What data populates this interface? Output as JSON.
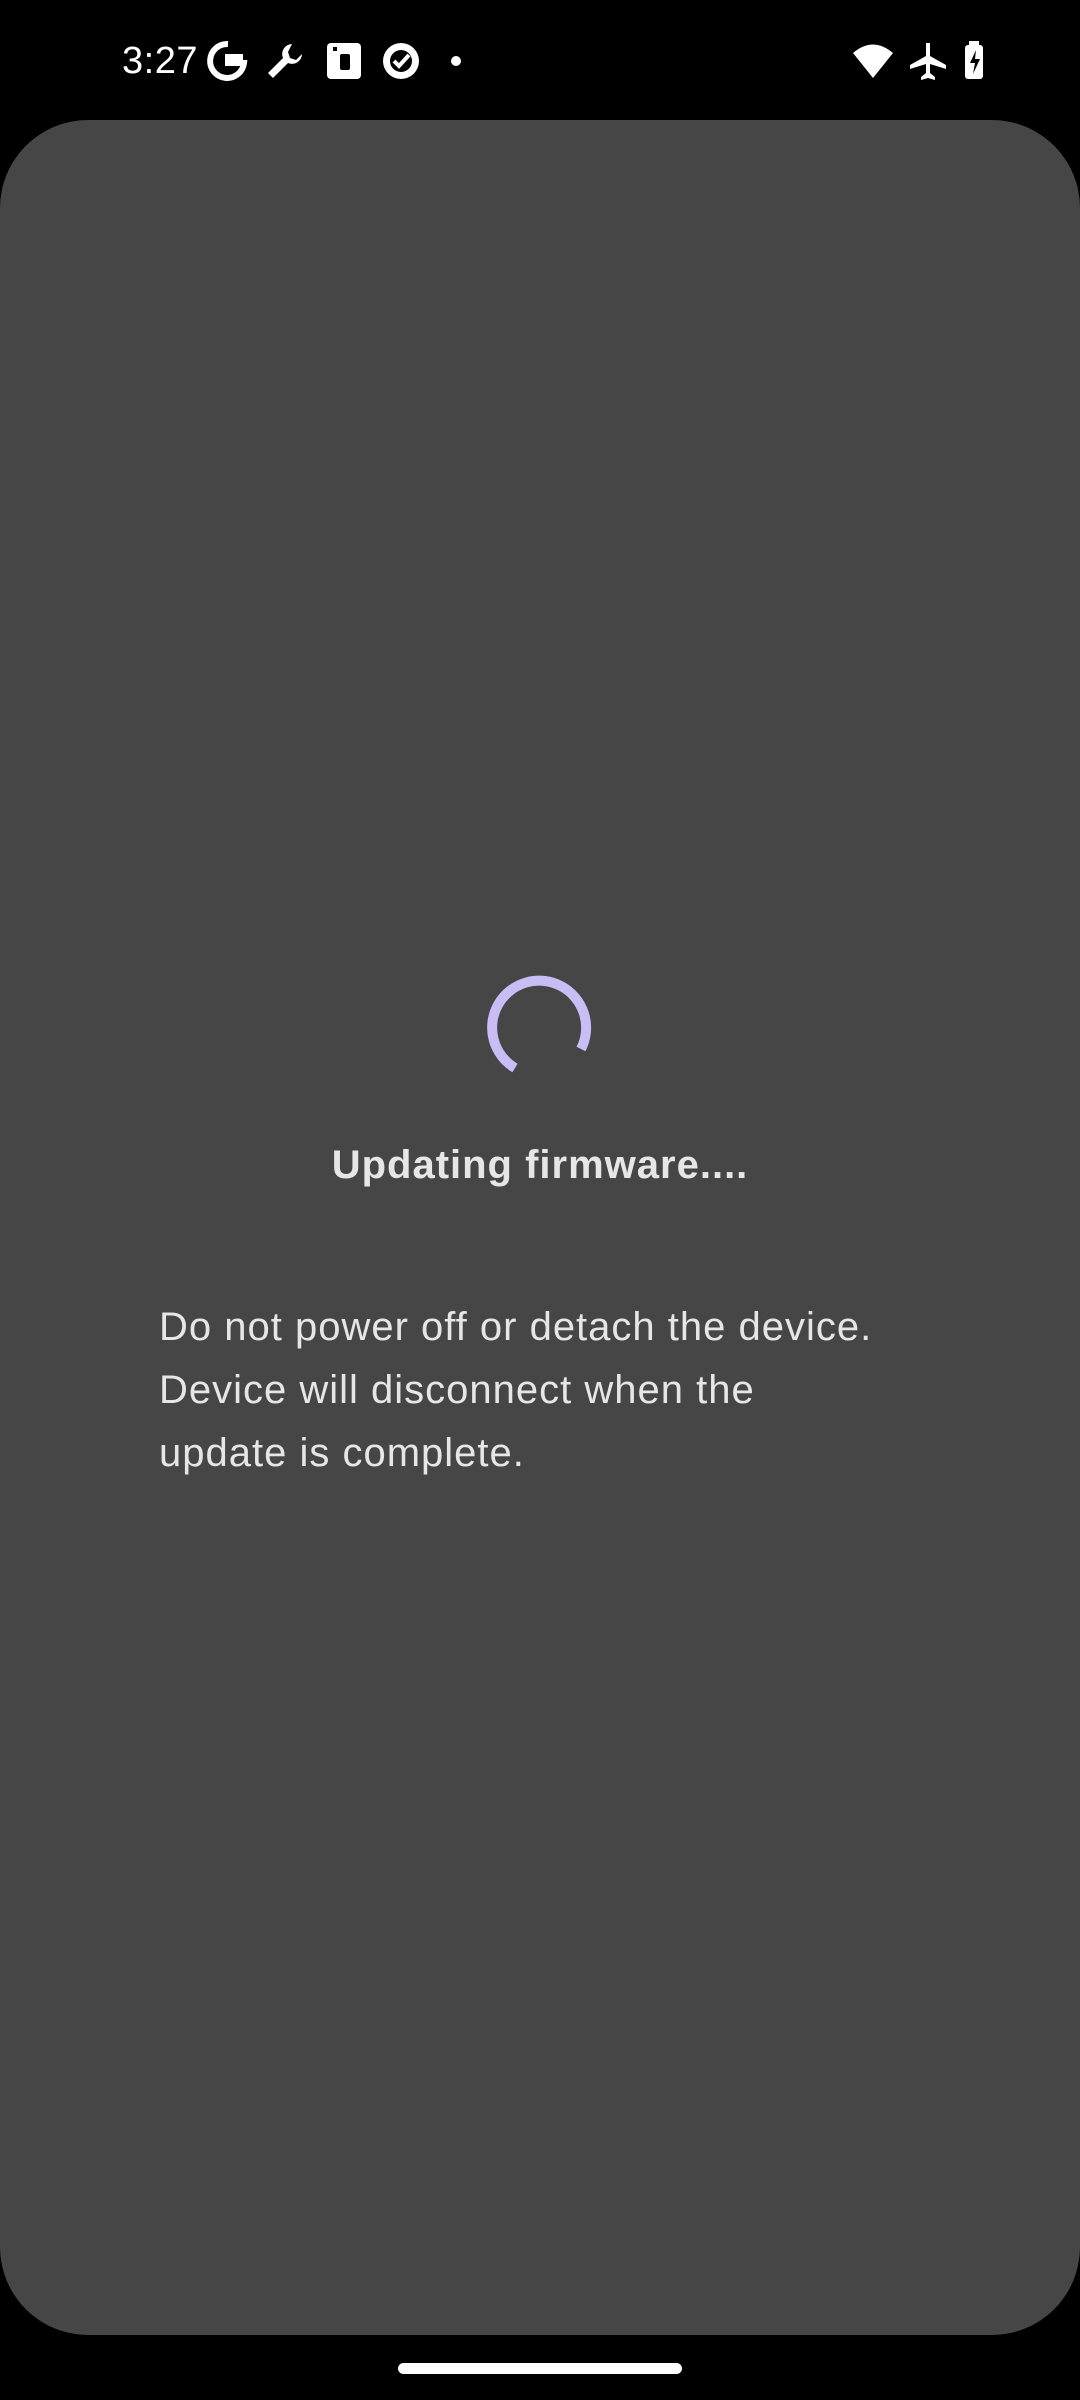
{
  "status_bar": {
    "time": "3:27",
    "left_icons": [
      "google-g-icon",
      "wrench-icon",
      "sim-card-icon",
      "check-badge-icon",
      "notification-dot-icon"
    ],
    "right_icons": [
      "wifi-icon",
      "airplane-icon",
      "battery-charging-icon"
    ]
  },
  "dialog": {
    "title": "Updating firmware....",
    "message": "Do not power off or detach the device.\nDevice will disconnect when the\nupdate is complete.",
    "spinner_color": "#C9BDF5",
    "background_color": "#464646"
  },
  "colors": {
    "text": "#E6E6E6",
    "status_bar_bg": "#000000"
  }
}
